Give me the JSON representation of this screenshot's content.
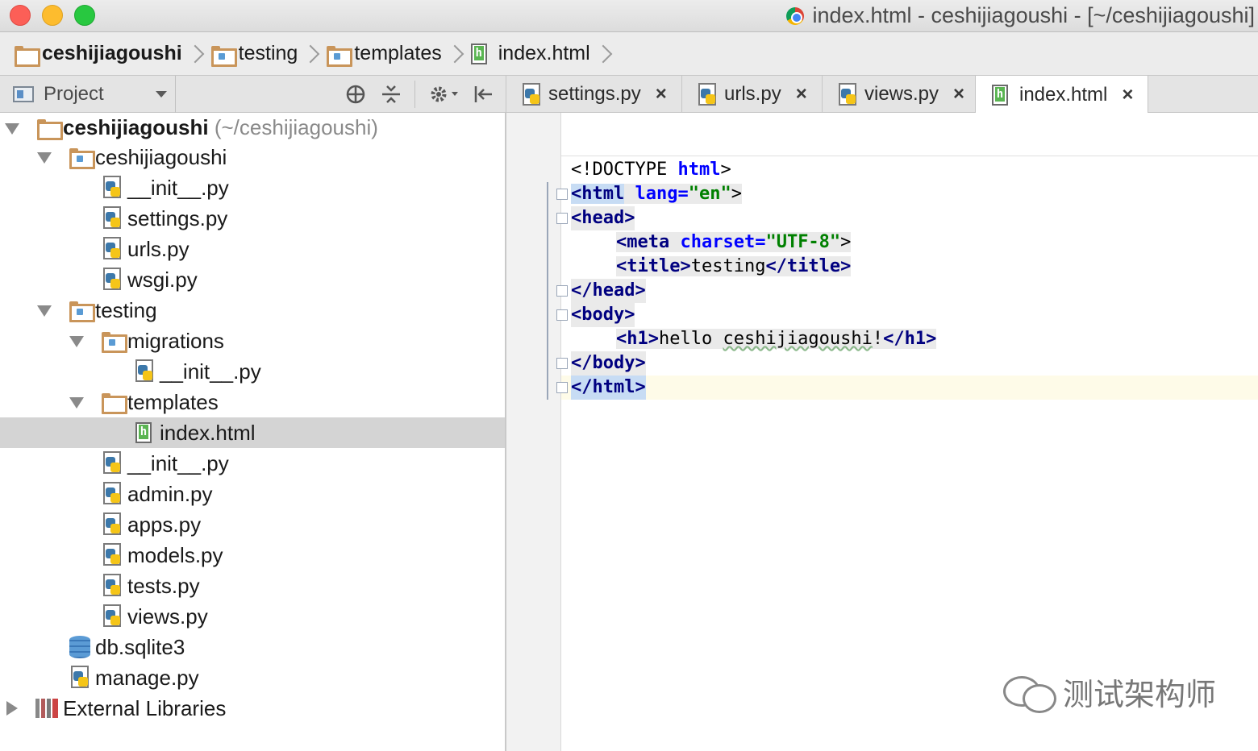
{
  "window": {
    "title": "index.html - ceshijiagoushi - [~/ceshijiagoushi]"
  },
  "breadcrumbs": [
    {
      "label": "ceshijiagoushi",
      "icon": "folder-icon"
    },
    {
      "label": "testing",
      "icon": "package-folder-icon"
    },
    {
      "label": "templates",
      "icon": "package-folder-icon"
    },
    {
      "label": "index.html",
      "icon": "html-file-icon"
    }
  ],
  "project_panel": {
    "selector_label": "Project"
  },
  "tabs": [
    {
      "label": "settings.py",
      "icon": "python-file-icon",
      "active": false
    },
    {
      "label": "urls.py",
      "icon": "python-file-icon",
      "active": false
    },
    {
      "label": "views.py",
      "icon": "python-file-icon",
      "active": false
    },
    {
      "label": "index.html",
      "icon": "html-file-icon",
      "active": true
    }
  ],
  "tab_close_glyph": "×",
  "tree": {
    "root_label": "ceshijiagoushi",
    "root_hint": "(~/ceshijiagoushi)",
    "items": [
      {
        "label": "ceshijiagoushi"
      },
      {
        "label": "__init__.py"
      },
      {
        "label": "settings.py"
      },
      {
        "label": "urls.py"
      },
      {
        "label": "wsgi.py"
      },
      {
        "label": "testing"
      },
      {
        "label": "migrations"
      },
      {
        "label": "__init__.py"
      },
      {
        "label": "templates"
      },
      {
        "label": "index.html"
      },
      {
        "label": "__init__.py"
      },
      {
        "label": "admin.py"
      },
      {
        "label": "apps.py"
      },
      {
        "label": "models.py"
      },
      {
        "label": "tests.py"
      },
      {
        "label": "views.py"
      },
      {
        "label": "db.sqlite3"
      },
      {
        "label": "manage.py"
      },
      {
        "label": "External Libraries"
      }
    ]
  },
  "editor": {
    "code": {
      "doctype_open": "<!DOCTYPE ",
      "html_kw": "html",
      "close_bracket": ">",
      "html_open": "<html",
      "space": " ",
      "lang_attr": "lang=",
      "lang_val": "\"en\"",
      "head_open": "<head>",
      "meta_open": "<meta",
      "charset_attr": "charset=",
      "charset_val": "\"UTF-8\"",
      "title_open": "<title>",
      "title_text": "testing",
      "title_close": "</title>",
      "head_close": "</head>",
      "body_open": "<body>",
      "h1_open": "<h1>",
      "h1_text_a": "hello ",
      "h1_text_b": "ceshijiagoushi",
      "h1_text_c": "!",
      "h1_close": "</h1>",
      "body_close": "</body>",
      "html_close": "</html>"
    }
  },
  "watermark": {
    "text": "测试架构师"
  }
}
